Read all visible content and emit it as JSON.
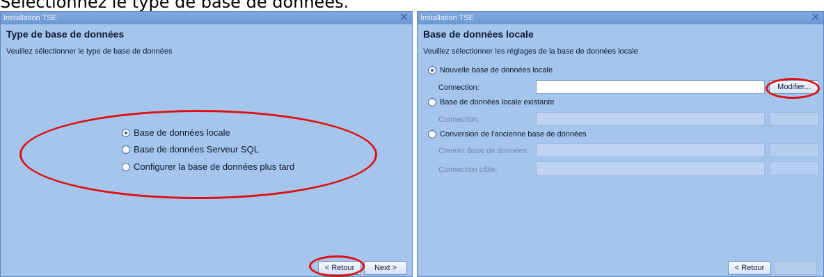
{
  "caption": "Sélectionnez le type de base de données.",
  "left_window": {
    "title": "Installation TSE",
    "heading": "Type de base de données",
    "subtitle": "Veuillez sélectionner le type de base de données",
    "options": [
      {
        "label": "Base de données locale",
        "checked": true
      },
      {
        "label": "Base de données Serveur SQL",
        "checked": false
      },
      {
        "label": "Configurer la base de données plus tard",
        "checked": false
      }
    ],
    "back_label": "< Retour",
    "next_label": "Next >"
  },
  "right_window": {
    "title": "Installation TSE",
    "heading": "Base de données locale",
    "subtitle": "Veuillez sélectionner les réglages de la base de données locale",
    "option_new": "Nouvelle base de données locale",
    "option_existing": "Base de données locale existante",
    "option_convert": "Conversion de l'ancienne base de données",
    "connection_label": "Connection:",
    "old_db_path_label": "Chemin Base de données:",
    "target_connection_label": "Connection cible:",
    "modify_label": "Modifier...",
    "back_label": "< Retour"
  },
  "annotation_color": "#dd1111"
}
